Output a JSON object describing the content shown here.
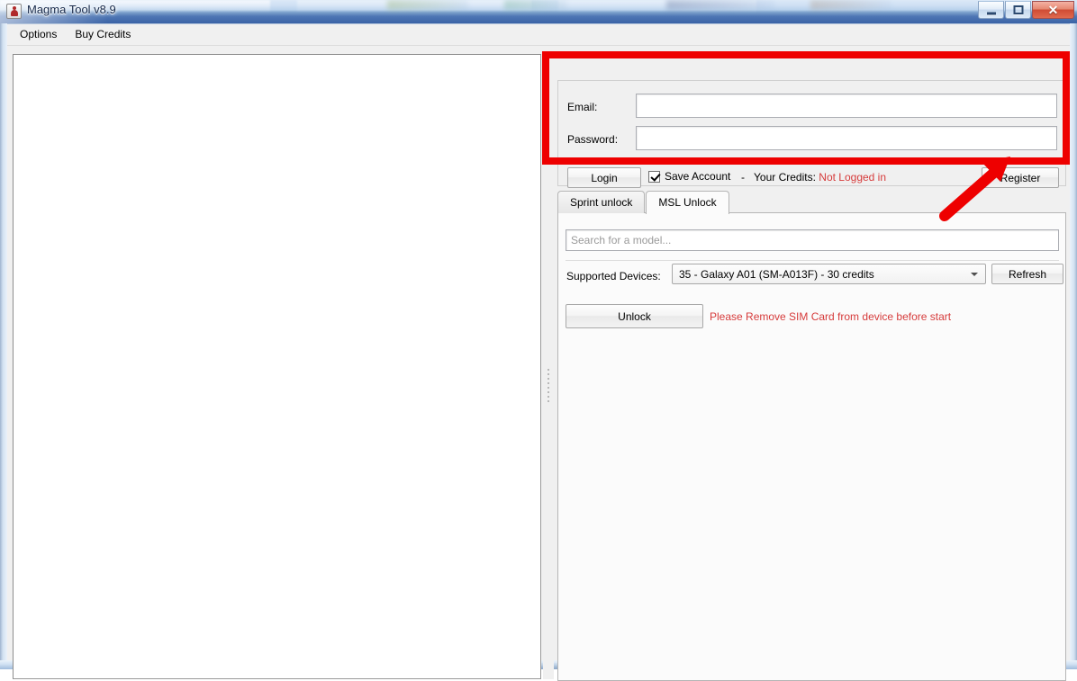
{
  "window": {
    "title": "Magma Tool v8.9",
    "icon": "app-icon",
    "buttons": {
      "minimize": "minimize-button",
      "maximize": "maximize-button",
      "close_label": "✕"
    }
  },
  "menu": {
    "items": [
      {
        "label": "Options"
      },
      {
        "label": "Buy Credits"
      }
    ]
  },
  "log_panel": {
    "content": ""
  },
  "login": {
    "email_label": "Email:",
    "email_value": "",
    "email_placeholder": "",
    "password_label": "Password:",
    "password_value": "",
    "password_placeholder": "",
    "login_button": "Login",
    "save_account_label": "Save Account",
    "save_account_checked": true,
    "separator_text": "-",
    "credits_label": "Your Credits:",
    "credits_value": "Not Logged in",
    "credits_value_color": "#d63b3b",
    "register_button": "Register"
  },
  "tabs": [
    {
      "label": "Sprint unlock",
      "active": false
    },
    {
      "label": "MSL Unlock",
      "active": true
    }
  ],
  "msl_panel": {
    "search_placeholder": "Search for a model...",
    "search_value": "",
    "supported_devices_label": "Supported Devices:",
    "selected_device": "35 - Galaxy A01 (SM-A013F) - 30 credits",
    "refresh_button": "Refresh",
    "unlock_button": "Unlock",
    "warning_text": "Please Remove SIM Card from device before start",
    "warning_color": "#d63b3b"
  },
  "annotations": {
    "highlight_color": "#ee0000",
    "arrow_color": "#ee0000",
    "highlight_target": "login-group",
    "arrow_target": "register-button"
  }
}
